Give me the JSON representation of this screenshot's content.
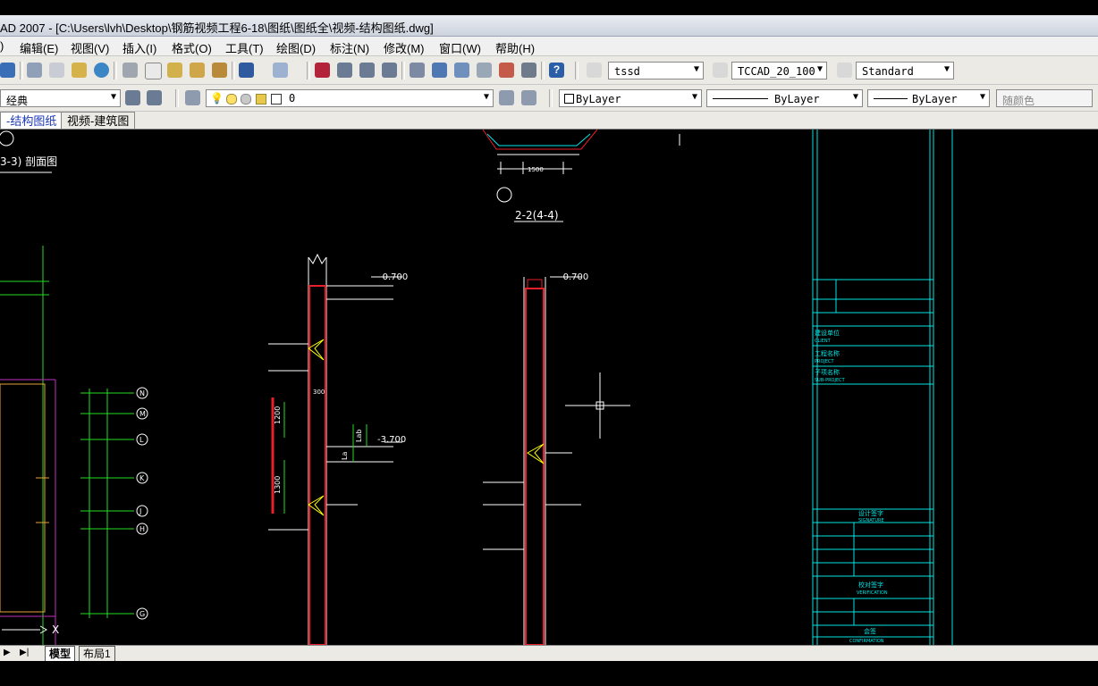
{
  "title_bar": {
    "text": "AD 2007 - [C:\\Users\\lvh\\Desktop\\钢筋视频工程6-18\\图纸\\图纸全\\视频-结构图纸.dwg]"
  },
  "menu": {
    "items": [
      {
        "label": ")"
      },
      {
        "label": "编辑(E)"
      },
      {
        "label": "视图(V)"
      },
      {
        "label": "插入(I)"
      },
      {
        "label": "格式(O)"
      },
      {
        "label": "工具(T)"
      },
      {
        "label": "绘图(D)"
      },
      {
        "label": "标注(N)"
      },
      {
        "label": "修改(M)"
      },
      {
        "label": "窗口(W)"
      },
      {
        "label": "帮助(H)"
      }
    ]
  },
  "toolbar1": {
    "text_style": "tssd",
    "dim_style": "TCCAD_20_100",
    "table_style": "Standard"
  },
  "toolbar2": {
    "workspace": "经典",
    "layer": "0",
    "color": "ByLayer",
    "linetype": "ByLayer",
    "lineweight": "ByLayer",
    "plotstyle": "随颜色"
  },
  "doc_tabs": [
    {
      "label": "-结构图纸"
    },
    {
      "label": "视频-建筑图"
    }
  ],
  "layout_tabs": {
    "model": "模型",
    "layout1": "布局1"
  },
  "drawing": {
    "section_3_3": "3-3) 剖面图",
    "section_2_2": "2-2(4-4)",
    "elev_1": "-0.700",
    "elev_2": "-0.700",
    "elev_3": "-3.700",
    "dim_1500": "1500",
    "dim_1200": "1200",
    "dim_1300": "1300",
    "dim_300": "300",
    "dim_lab": "Lab",
    "dim_la": "La",
    "axis_labels": [
      "N",
      "M",
      "L",
      "K",
      "J",
      "H",
      "G"
    ],
    "title_block": {
      "construction": "建设单位",
      "construction_en": "CLIENT",
      "project": "工程名称",
      "project_en": "PROJECT",
      "subproject": "子项名称",
      "subproject_en": "SUB-PROJECT",
      "signature": "设计签字",
      "signature_en": "SIGNATURE",
      "verification": "校对签字",
      "verification_en": "VERIFICATION",
      "confirm": "会签",
      "confirm_en": "CONFIRMATION"
    }
  },
  "colors": {
    "wall_red": "#e8202a",
    "cyan": "#00e5e5",
    "green": "#22dd22",
    "yellow": "#ffff00",
    "magenta": "#c030c0",
    "white": "#ffffff"
  }
}
